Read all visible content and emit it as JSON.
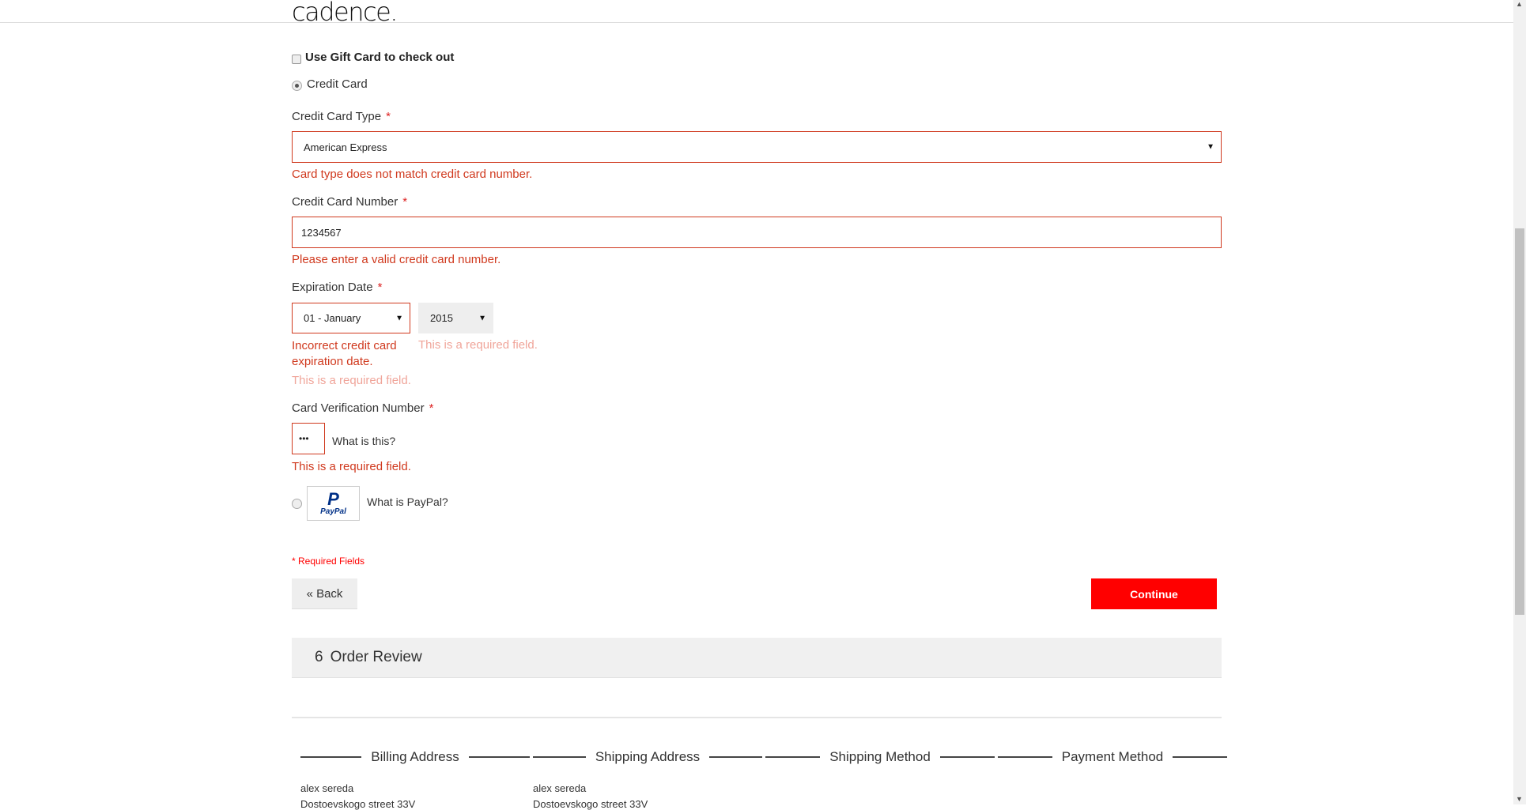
{
  "header": {
    "logo": "cadence."
  },
  "payment": {
    "gift_card_label": "Use Gift Card to check out",
    "credit_card_label": "Credit Card",
    "card_type": {
      "label": "Credit Card Type",
      "required": "*",
      "value": "American Express",
      "error": "Card type does not match credit card number."
    },
    "card_number": {
      "label": "Credit Card Number",
      "required": "*",
      "value": "1234567",
      "error": "Please enter a valid credit card number."
    },
    "expiration": {
      "label": "Expiration Date",
      "required": "*",
      "month": "01 - January",
      "year": "2015",
      "month_error": "Incorrect credit card expiration date.",
      "year_error": "This is a required field.",
      "month_error2": "This is a required field."
    },
    "cvv": {
      "label": "Card Verification Number",
      "required": "*",
      "value": "•••",
      "help": "What is this?",
      "error": "This is a required field."
    },
    "paypal": {
      "logo": "PayPal",
      "help": "What is PayPal?"
    },
    "required_note": "* Required Fields",
    "back_label": "« Back",
    "continue_label": "Continue"
  },
  "order_review": {
    "step": "6",
    "title": "Order Review",
    "columns": [
      {
        "title": "Billing Address",
        "name": "alex sereda",
        "street": "Dostoevskogo street 33V"
      },
      {
        "title": "Shipping Address",
        "name": "alex sereda",
        "street": "Dostoevskogo street 33V"
      },
      {
        "title": "Shipping Method"
      },
      {
        "title": "Payment Method"
      }
    ]
  },
  "colors": {
    "error": "#d0391e",
    "accent": "#ff0000"
  }
}
